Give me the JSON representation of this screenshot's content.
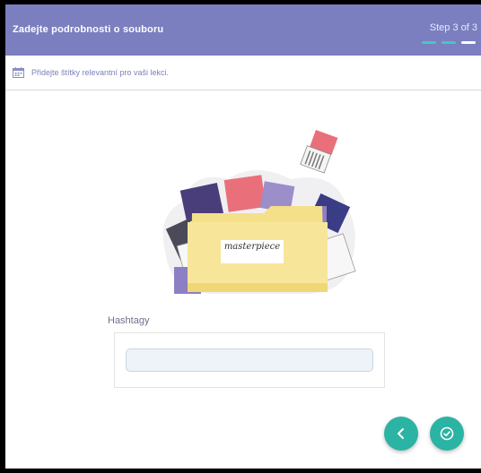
{
  "header": {
    "title": "Zadejte podrobnosti o souboru",
    "step_label": "Step 3 of 3",
    "steps_total": 3,
    "current_step": 3
  },
  "hint": {
    "text": "Přidejte štítky relevantní pro vaši lekci.",
    "icon": "calendar-icon"
  },
  "illustration": {
    "folder_label": "masterpiece"
  },
  "hashtags": {
    "label": "Hashtagy",
    "value": "",
    "placeholder": ""
  },
  "actions": {
    "back_icon": "chevron-left-icon",
    "finish_icon": "check-circle-icon"
  },
  "colors": {
    "header": "#7b7fbf",
    "accent": "#2bb3a3",
    "step_done": "#4bc3c3",
    "step_current": "#ffffff"
  }
}
